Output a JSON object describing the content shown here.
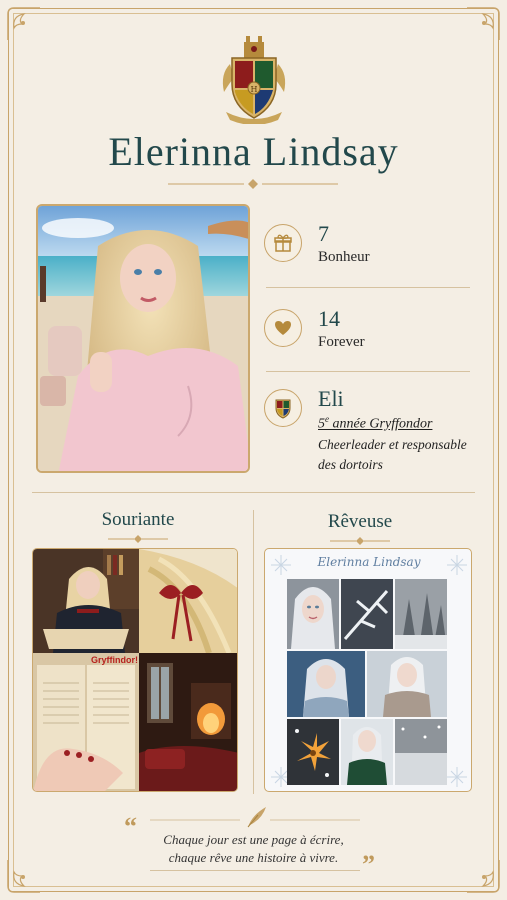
{
  "profile": {
    "name": "Elerinna Lindsay"
  },
  "stats": [
    {
      "value": "7",
      "label": "Bonheur",
      "icon": "gift-icon"
    },
    {
      "value": "14",
      "label": "Forever",
      "icon": "heart-icon"
    },
    {
      "value": "Eli",
      "label": "",
      "icon": "hogwarts-shield-icon"
    }
  ],
  "house": {
    "year_number": "5",
    "year_suffix": "e",
    "year_rest": " année Gryffondor",
    "role": "Cheerleader et responsable des dortoirs"
  },
  "sections": {
    "left_title": "Souriante",
    "right_title": "Rêveuse"
  },
  "collage": {
    "tag": "Gryffindor!"
  },
  "winter": {
    "title": "Elerinna Lindsay"
  },
  "quote": {
    "line1": "Chaque jour est une page à écrire,",
    "line2": "chaque rêve une histoire à vivre."
  },
  "colors": {
    "background": "#f4eee4",
    "gold": "#c8a46a",
    "teal": "#22484b"
  }
}
